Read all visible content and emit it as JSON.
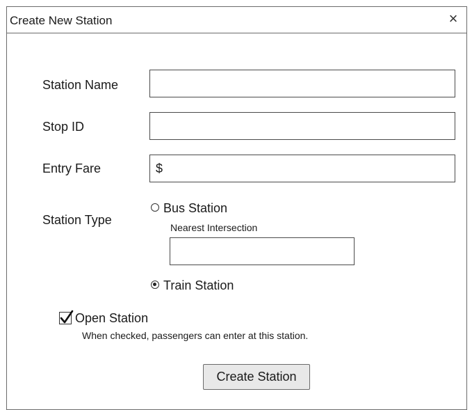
{
  "dialog": {
    "title": "Create New Station",
    "close_glyph": "×"
  },
  "form": {
    "station_name": {
      "label": "Station Name",
      "value": ""
    },
    "stop_id": {
      "label": "Stop ID",
      "value": ""
    },
    "entry_fare": {
      "label": "Entry Fare",
      "value": "$"
    },
    "station_type": {
      "label": "Station Type",
      "options": [
        {
          "label": "Bus Station",
          "selected": false
        },
        {
          "label": "Train Station",
          "selected": true
        }
      ],
      "nearest_intersection": {
        "label": "Nearest Intersection",
        "value": ""
      }
    },
    "open_station": {
      "label": "Open Station",
      "checked": true,
      "help": "When checked, passengers can enter at this station."
    },
    "submit_label": "Create Station"
  },
  "icons": {
    "close": "close-icon",
    "radio": "radio-icon",
    "checkbox": "checkmark-icon"
  }
}
